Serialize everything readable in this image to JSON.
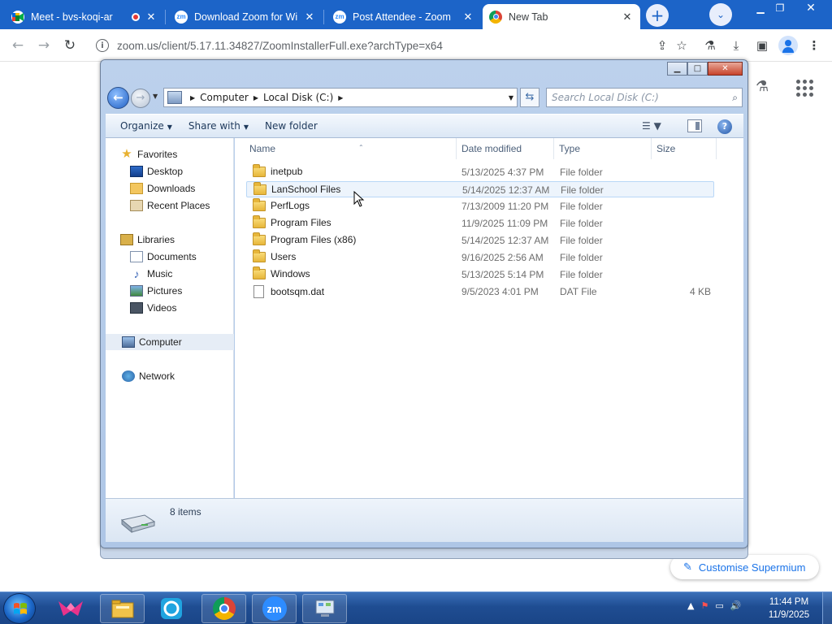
{
  "browser": {
    "tabs": [
      {
        "title": "Meet - bvs-koqi-ar",
        "favicon": "google-meet-icon",
        "recording": true
      },
      {
        "title": "Download Zoom for Wi",
        "favicon": "zoom-icon"
      },
      {
        "title": "Post Attendee - Zoom",
        "favicon": "zoom-icon"
      },
      {
        "title": "New Tab",
        "favicon": "chrome-icon",
        "active": true
      }
    ],
    "new_tab_symbol": "+",
    "url": "zoom.us/client/5.17.11.34827/ZoomInstallerFull.exe?archType=x64",
    "customise_label": "Customise Supermium"
  },
  "explorer": {
    "breadcrumb": [
      "Computer",
      "Local Disk (C:)"
    ],
    "search_placeholder": "Search Local Disk (C:)",
    "commands": {
      "organize": "Organize",
      "share_with": "Share with",
      "new_folder": "New folder"
    },
    "columns": {
      "name": "Name",
      "date": "Date modified",
      "type": "Type",
      "size": "Size"
    },
    "nav": {
      "favorites": "Favorites",
      "desktop": "Desktop",
      "downloads": "Downloads",
      "recent": "Recent Places",
      "libraries": "Libraries",
      "documents": "Documents",
      "music": "Music",
      "pictures": "Pictures",
      "videos": "Videos",
      "computer": "Computer",
      "network": "Network"
    },
    "files": [
      {
        "name": "inetpub",
        "date": "5/13/2025 4:37 PM",
        "type": "File folder",
        "size": ""
      },
      {
        "name": "LanSchool Files",
        "date": "5/14/2025 12:37 AM",
        "type": "File folder",
        "size": ""
      },
      {
        "name": "PerfLogs",
        "date": "7/13/2009 11:20 PM",
        "type": "File folder",
        "size": ""
      },
      {
        "name": "Program Files",
        "date": "11/9/2025 11:09 PM",
        "type": "File folder",
        "size": ""
      },
      {
        "name": "Program Files (x86)",
        "date": "5/14/2025 12:37 AM",
        "type": "File folder",
        "size": ""
      },
      {
        "name": "Users",
        "date": "9/16/2025 2:56 AM",
        "type": "File folder",
        "size": ""
      },
      {
        "name": "Windows",
        "date": "5/13/2025 5:14 PM",
        "type": "File folder",
        "size": ""
      },
      {
        "name": "bootsqm.dat",
        "date": "9/5/2023 4:01 PM",
        "type": "DAT File",
        "size": "4 KB"
      }
    ],
    "item_count": "8 items"
  },
  "taskbar": {
    "time": "11:44 PM",
    "date": "11/9/2025",
    "zoom_label": "zm"
  }
}
